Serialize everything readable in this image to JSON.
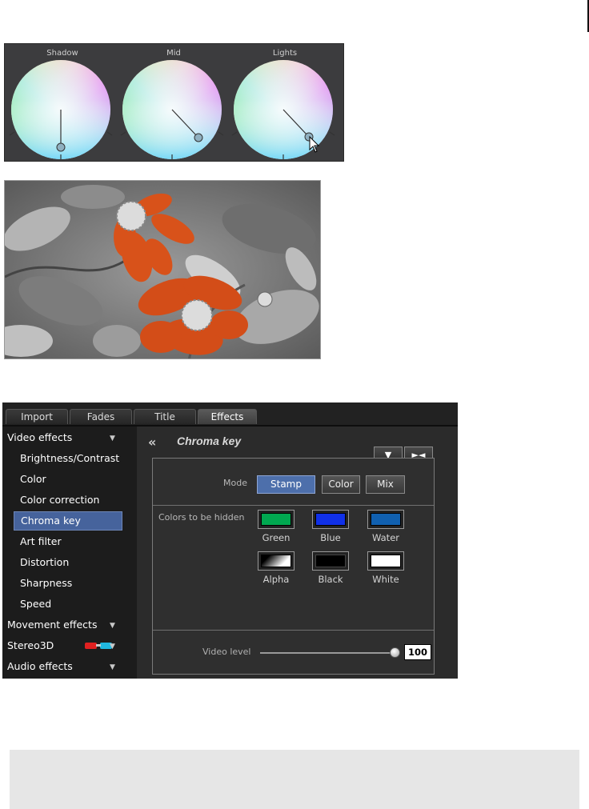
{
  "wheels": [
    {
      "label": "Shadow"
    },
    {
      "label": "Mid"
    },
    {
      "label": "Lights"
    }
  ],
  "panel": {
    "tabs": [
      {
        "label": "Import",
        "active": false
      },
      {
        "label": "Fades",
        "active": false
      },
      {
        "label": "Title",
        "active": false
      },
      {
        "label": "Effects",
        "active": true
      }
    ],
    "sidebar": {
      "video_effects": "Video effects",
      "items": [
        {
          "label": "Brightness/Contrast"
        },
        {
          "label": "Color"
        },
        {
          "label": "Color correction"
        },
        {
          "label": "Chroma key",
          "selected": true
        },
        {
          "label": "Art filter"
        },
        {
          "label": "Distortion"
        },
        {
          "label": "Sharpness"
        },
        {
          "label": "Speed"
        }
      ],
      "movement_effects": "Movement effects",
      "stereo3d": "Stereo3D",
      "audio_effects": "Audio effects"
    },
    "main": {
      "title": "Chroma key",
      "mode_label": "Mode",
      "mode_buttons": [
        {
          "label": "Stamp",
          "active": true
        },
        {
          "label": "Color",
          "active": false
        },
        {
          "label": "Mix",
          "active": false
        }
      ],
      "colors_label": "Colors to be hidden",
      "swatches": [
        {
          "label": "Green",
          "color": "#00a850"
        },
        {
          "label": "Blue",
          "color": "#1030e8"
        },
        {
          "label": "Water",
          "color": "#1060b0"
        },
        {
          "label": "Alpha",
          "color": "gradient"
        },
        {
          "label": "Black",
          "color": "#000000"
        },
        {
          "label": "White",
          "color": "#ffffff"
        }
      ],
      "video_level_label": "Video level",
      "video_level_value": "100",
      "video_level_fraction": 1.0
    }
  },
  "colors": {
    "selection": "#46639c",
    "mode_active": "#4d6fab",
    "flower": "#d8521a"
  }
}
